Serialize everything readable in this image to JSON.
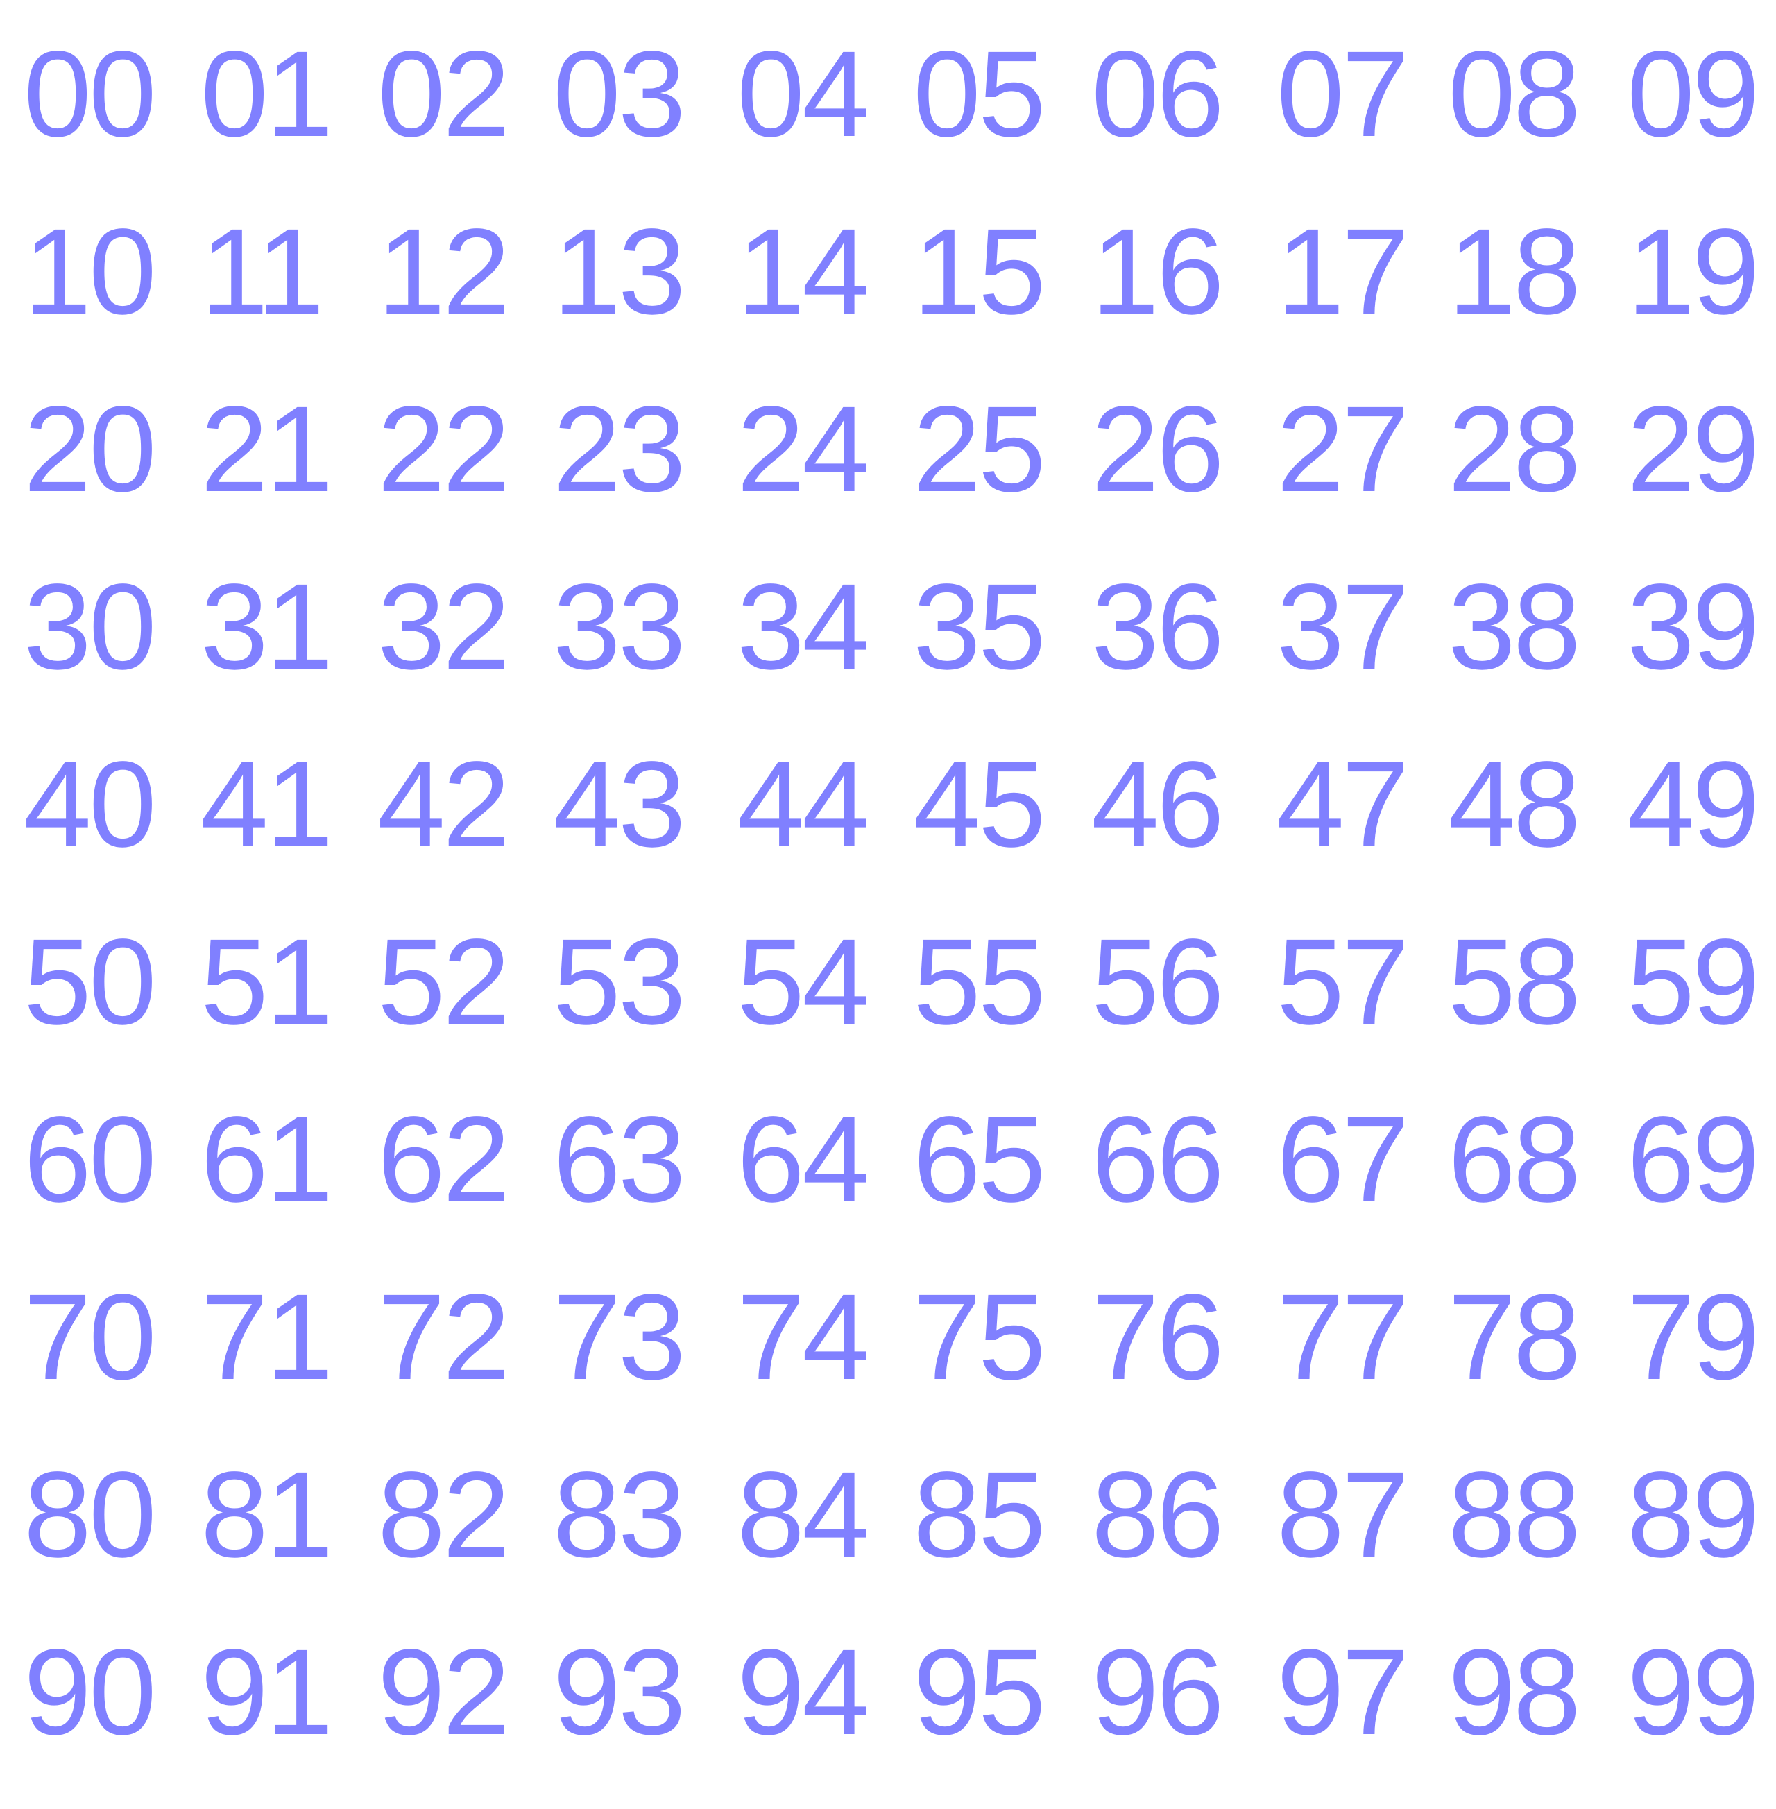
{
  "text_color": "#8080ff",
  "background_color": "#ffffff",
  "rows": [
    [
      "00",
      "01",
      "02",
      "03",
      "04",
      "05",
      "06",
      "07",
      "08",
      "09"
    ],
    [
      "10",
      "11",
      "12",
      "13",
      "14",
      "15",
      "16",
      "17",
      "18",
      "19"
    ],
    [
      "20",
      "21",
      "22",
      "23",
      "24",
      "25",
      "26",
      "27",
      "28",
      "29"
    ],
    [
      "30",
      "31",
      "32",
      "33",
      "34",
      "35",
      "36",
      "37",
      "38",
      "39"
    ],
    [
      "40",
      "41",
      "42",
      "43",
      "44",
      "45",
      "46",
      "47",
      "48",
      "49"
    ],
    [
      "50",
      "51",
      "52",
      "53",
      "54",
      "55",
      "56",
      "57",
      "58",
      "59"
    ],
    [
      "60",
      "61",
      "62",
      "63",
      "64",
      "65",
      "66",
      "67",
      "68",
      "69"
    ],
    [
      "70",
      "71",
      "72",
      "73",
      "74",
      "75",
      "76",
      "77",
      "78",
      "79"
    ],
    [
      "80",
      "81",
      "82",
      "83",
      "84",
      "85",
      "86",
      "87",
      "88",
      "89"
    ],
    [
      "90",
      "91",
      "92",
      "93",
      "94",
      "95",
      "96",
      "97",
      "98",
      "99"
    ]
  ]
}
